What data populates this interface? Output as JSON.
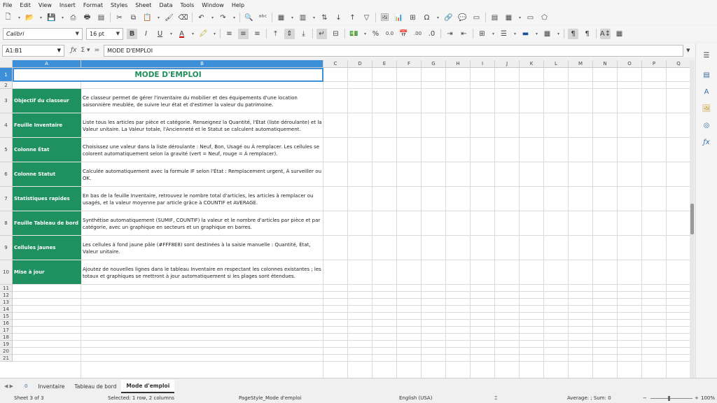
{
  "menu": [
    "File",
    "Edit",
    "View",
    "Insert",
    "Format",
    "Styles",
    "Sheet",
    "Data",
    "Tools",
    "Window",
    "Help"
  ],
  "toolbar2": {
    "font_name": "Calibri",
    "font_size": "16 pt",
    "bold": "B",
    "italic": "I",
    "underline": "U",
    "font_color_letter": "A",
    "percent": "%",
    "decimal_zero": "0.0",
    "decimal_add": ".00"
  },
  "formula_bar": {
    "name_box": "A1:B1",
    "content": "MODE D'EMPLOI"
  },
  "columns": [
    "A",
    "B",
    "C",
    "D",
    "E",
    "F",
    "G",
    "H",
    "I",
    "J",
    "K",
    "L",
    "M",
    "N",
    "O",
    "P",
    "Q"
  ],
  "rows": [
    "1",
    "2",
    "3",
    "4",
    "5",
    "6",
    "7",
    "8",
    "9",
    "10",
    "11",
    "12",
    "13",
    "14",
    "15",
    "16",
    "17",
    "18",
    "19",
    "20",
    "21"
  ],
  "sheet": {
    "title": "MODE D'EMPLOI",
    "entries": [
      {
        "label": "Objectif du classeur",
        "text": "Ce classeur permet de gérer l'inventaire du mobilier et des équipements d'une location saisonnière meublée, de suivre leur état et d'estimer la valeur du patrimoine."
      },
      {
        "label": "Feuille Inventaire",
        "text": "Liste tous les articles par pièce et catégorie. Renseignez la Quantité, l'État (liste déroulante) et la Valeur unitaire. La Valeur totale, l'Ancienneté et le Statut se calculent automatiquement."
      },
      {
        "label": "Colonne État",
        "text": "Choisissez une valeur dans la liste déroulante : Neuf, Bon, Usagé ou À remplacer. Les cellules se colorent automatiquement selon la gravité (vert = Neuf, rouge = À remplacer)."
      },
      {
        "label": "Colonne Statut",
        "text": "Calculée automatiquement avec la formule IF selon l'État : Remplacement urgent, À surveiller ou OK."
      },
      {
        "label": "Statistiques rapides",
        "text": "En bas de la feuille Inventaire, retrouvez le nombre total d'articles, les articles à remplacer ou usagés, et la valeur moyenne par article grâce à COUNTIF et AVERAGE."
      },
      {
        "label": "Feuille Tableau de bord",
        "text": "Synthétise automatiquement (SUMIF, COUNTIF) la valeur et le nombre d'articles par pièce et par catégorie, avec un graphique en secteurs et un graphique en barres."
      },
      {
        "label": "Cellules jaunes",
        "text": "Les cellules à fond jaune pâle (#FFF8E8) sont destinées à la saisie manuelle : Quantité, État, Valeur unitaire."
      },
      {
        "label": "Mise à jour",
        "text": "Ajoutez de nouvelles lignes dans le tableau Inventaire en respectant les colonnes existantes ; les totaux et graphiques se mettront à jour automatiquement si les plages sont étendues."
      }
    ]
  },
  "tabs": {
    "add_label": "0",
    "items": [
      "Inventaire",
      "Tableau de bord",
      "Mode d'emploi"
    ],
    "active": "Mode d'emploi"
  },
  "status": {
    "sheet": "Sheet 3 of 3",
    "selection": "Selected: 1 row, 2 columns",
    "page_style": "PageStyle_Mode d'emploi",
    "language": "English (USA)",
    "summary": "Average: ; Sum: 0",
    "zoom": "100%"
  },
  "colors": {
    "label_fill": "#1f9160",
    "title_text": "#1f8f5c",
    "selection": "#3d8fd9"
  }
}
